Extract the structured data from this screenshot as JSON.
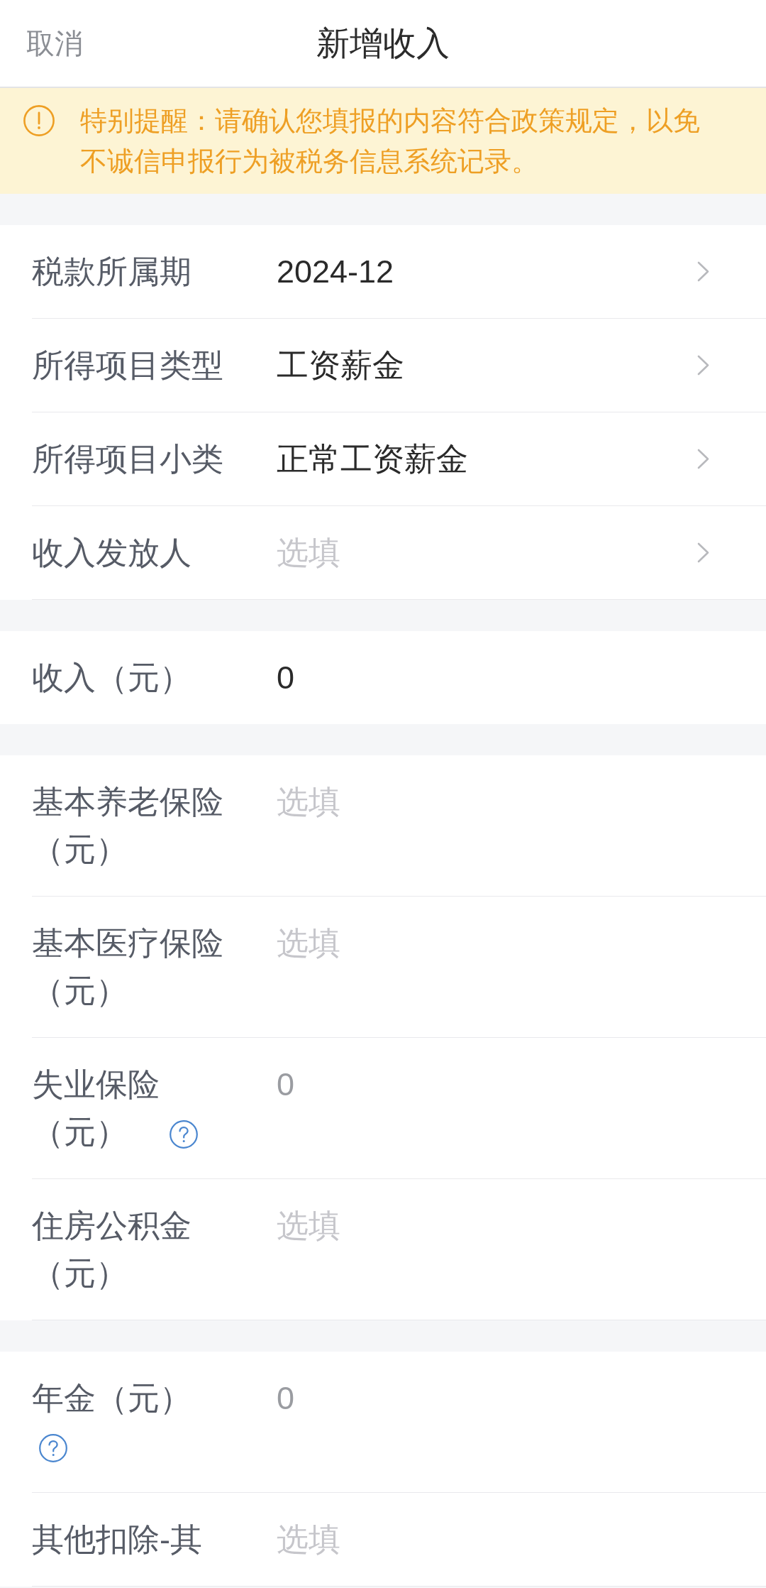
{
  "header": {
    "cancel": "取消",
    "title": "新增收入"
  },
  "notice": {
    "text": "特别提醒：请确认您填报的内容符合政策规定，以免不诚信申报行为被税务信息系统记录。"
  },
  "sections": [
    {
      "rows": [
        {
          "kind": "select",
          "label": "税款所属期",
          "value": "2024-12",
          "disabled": false,
          "help": false
        },
        {
          "kind": "select",
          "label": "所得项目类型",
          "value": "工资薪金",
          "disabled": false,
          "help": false
        },
        {
          "kind": "select",
          "label": "所得项目小类",
          "value": "正常工资薪金",
          "disabled": false,
          "help": false
        },
        {
          "kind": "select",
          "label": "收入发放人",
          "placeholder": "选填",
          "disabled": false,
          "help": false
        }
      ]
    },
    {
      "rows": [
        {
          "kind": "input",
          "label": "收入（元）",
          "value": "0",
          "disabled": false,
          "help": false
        }
      ]
    },
    {
      "rows": [
        {
          "kind": "input",
          "label": "基本养老保险（元）",
          "placeholder": "选填",
          "disabled": false,
          "help": false
        },
        {
          "kind": "input",
          "label": "基本医疗保险（元）",
          "placeholder": "选填",
          "disabled": false,
          "help": false
        },
        {
          "kind": "input",
          "label": "失业保险（元）",
          "value": "0",
          "disabled": true,
          "help": true
        },
        {
          "kind": "input",
          "label": "住房公积金（元）",
          "placeholder": "选填",
          "disabled": false,
          "help": false
        }
      ]
    },
    {
      "rows": [
        {
          "kind": "input",
          "label": "年金（元）",
          "value": "0",
          "disabled": true,
          "help": true
        },
        {
          "kind": "input",
          "label": "其他扣除-其",
          "placeholder": "选填",
          "disabled": false,
          "help": false
        }
      ]
    }
  ]
}
